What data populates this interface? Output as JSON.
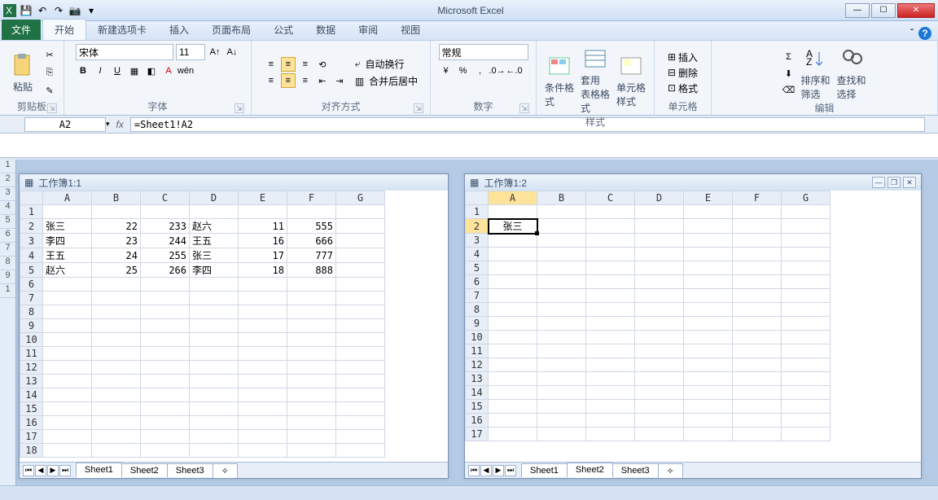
{
  "app": {
    "title": "Microsoft Excel"
  },
  "qat": {
    "save": "💾",
    "undo": "↶",
    "redo": "↷",
    "camera": "📷"
  },
  "tabs": {
    "file": "文件",
    "items": [
      "开始",
      "新建选项卡",
      "插入",
      "页面布局",
      "公式",
      "数据",
      "审阅",
      "视图"
    ],
    "active": 0
  },
  "ribbon": {
    "clipboard": {
      "paste": "粘贴",
      "label": "剪贴板"
    },
    "font": {
      "name": "宋体",
      "size": "11",
      "label": "字体",
      "bold": "B",
      "italic": "I",
      "underline": "U"
    },
    "align": {
      "wrap": "自动换行",
      "merge": "合并后居中",
      "label": "对齐方式"
    },
    "number": {
      "format": "常规",
      "label": "数字"
    },
    "styles": {
      "cond": "条件格式",
      "table": "套用\n表格格式",
      "cell": "单元格样式",
      "label": "样式"
    },
    "cells": {
      "insert": "插入",
      "delete": "删除",
      "format": "格式",
      "label": "单元格"
    },
    "edit": {
      "sort": "排序和筛选",
      "find": "查找和选择",
      "label": "编辑"
    }
  },
  "formula": {
    "cellref": "A2",
    "value": "=Sheet1!A2"
  },
  "win1": {
    "title": "工作簿1:1",
    "cols": [
      "A",
      "B",
      "C",
      "D",
      "E",
      "F",
      "G"
    ],
    "rows": [
      {
        "n": 1,
        "cells": [
          "",
          "",
          "",
          "",
          "",
          "",
          ""
        ]
      },
      {
        "n": 2,
        "cells": [
          "张三",
          "22",
          "233",
          "赵六",
          "11",
          "555",
          ""
        ]
      },
      {
        "n": 3,
        "cells": [
          "李四",
          "23",
          "244",
          "王五",
          "16",
          "666",
          ""
        ]
      },
      {
        "n": 4,
        "cells": [
          "王五",
          "24",
          "255",
          "张三",
          "17",
          "777",
          ""
        ]
      },
      {
        "n": 5,
        "cells": [
          "赵六",
          "25",
          "266",
          "李四",
          "18",
          "888",
          ""
        ]
      },
      {
        "n": 6,
        "cells": [
          "",
          "",
          "",
          "",
          "",
          "",
          ""
        ]
      },
      {
        "n": 7,
        "cells": [
          "",
          "",
          "",
          "",
          "",
          "",
          ""
        ]
      },
      {
        "n": 8,
        "cells": [
          "",
          "",
          "",
          "",
          "",
          "",
          ""
        ]
      },
      {
        "n": 9,
        "cells": [
          "",
          "",
          "",
          "",
          "",
          "",
          ""
        ]
      },
      {
        "n": 10,
        "cells": [
          "",
          "",
          "",
          "",
          "",
          "",
          ""
        ]
      },
      {
        "n": 11,
        "cells": [
          "",
          "",
          "",
          "",
          "",
          "",
          ""
        ]
      },
      {
        "n": 12,
        "cells": [
          "",
          "",
          "",
          "",
          "",
          "",
          ""
        ]
      },
      {
        "n": 13,
        "cells": [
          "",
          "",
          "",
          "",
          "",
          "",
          ""
        ]
      },
      {
        "n": 14,
        "cells": [
          "",
          "",
          "",
          "",
          "",
          "",
          ""
        ]
      },
      {
        "n": 15,
        "cells": [
          "",
          "",
          "",
          "",
          "",
          "",
          ""
        ]
      },
      {
        "n": 16,
        "cells": [
          "",
          "",
          "",
          "",
          "",
          "",
          ""
        ]
      },
      {
        "n": 17,
        "cells": [
          "",
          "",
          "",
          "",
          "",
          "",
          ""
        ]
      },
      {
        "n": 18,
        "cells": [
          "",
          "",
          "",
          "",
          "",
          "",
          ""
        ]
      }
    ],
    "tabs": [
      "Sheet1",
      "Sheet2",
      "Sheet3"
    ],
    "activeTab": 0
  },
  "win2": {
    "title": "工作簿1:2",
    "cols": [
      "A",
      "B",
      "C",
      "D",
      "E",
      "F",
      "G"
    ],
    "a2": "张三",
    "rows": 17,
    "tabs": [
      "Sheet1",
      "Sheet2",
      "Sheet3"
    ],
    "activeTab": 1
  }
}
